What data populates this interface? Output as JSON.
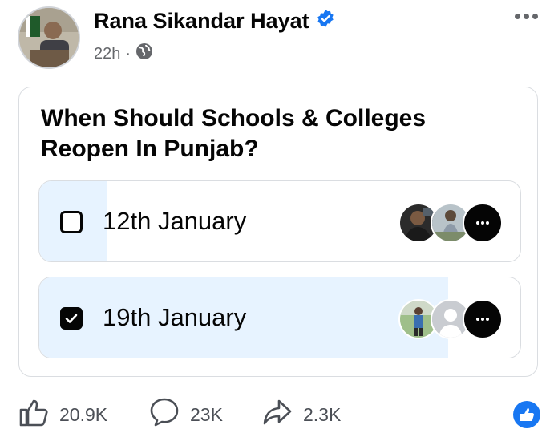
{
  "post": {
    "author": "Rana Sikandar Hayat",
    "time": "22h",
    "separator": "·",
    "verified_icon": "verified-badge-icon",
    "privacy_icon": "globe-icon",
    "more_icon": "more-options-icon"
  },
  "poll": {
    "question": "When Should Schools & Colleges Reopen In Punjab?",
    "options": [
      {
        "label": "12th January",
        "checked": false,
        "vote_share": 0.14,
        "voters": [
          "voter-avatar",
          "voter-avatar",
          "more-voters"
        ]
      },
      {
        "label": "19th January",
        "checked": true,
        "vote_share": 0.85,
        "voters": [
          "voter-avatar",
          "default-avatar",
          "more-voters"
        ]
      }
    ],
    "colors": {
      "fill": "#e7f3ff",
      "border": "#dadde1"
    }
  },
  "footer": {
    "likes": "20.9K",
    "comments": "23K",
    "shares": "2.3K",
    "like_icon": "thumbs-up-icon",
    "comment_icon": "comment-bubble-icon",
    "share_icon": "share-arrow-icon",
    "reaction_icon": "like-reaction-icon",
    "accent": "#1877f2"
  }
}
